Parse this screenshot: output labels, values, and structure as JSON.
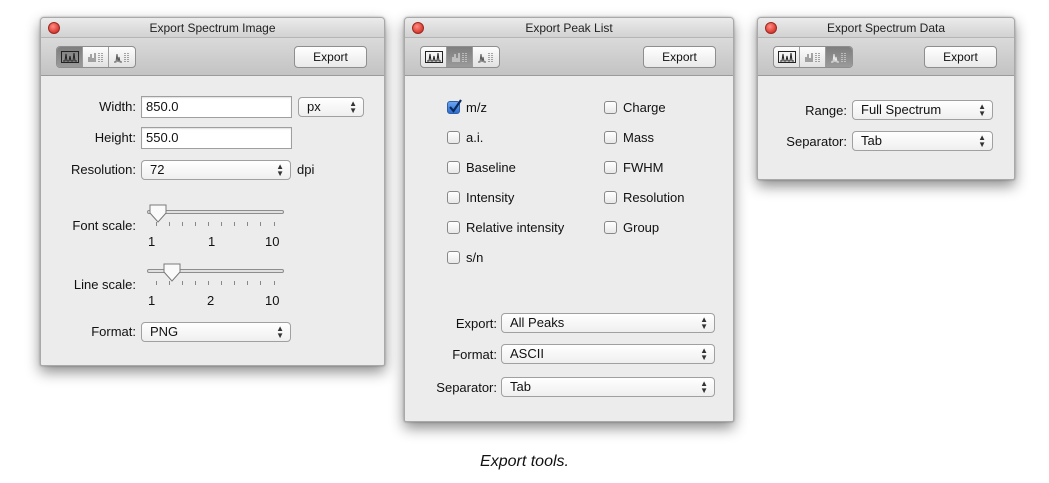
{
  "image_window": {
    "title": "Export Spectrum Image",
    "export_label": "Export",
    "width_label": "Width:",
    "width_value": "850.0",
    "unit": "px",
    "height_label": "Height:",
    "height_value": "550.0",
    "resolution_label": "Resolution:",
    "resolution_value": "72",
    "resolution_unit": "dpi",
    "font_scale_label": "Font scale:",
    "font_scale": {
      "min": "1",
      "value": "1",
      "max": "10"
    },
    "line_scale_label": "Line scale:",
    "line_scale": {
      "min": "1",
      "value": "2",
      "max": "10"
    },
    "format_label": "Format:",
    "format_value": "PNG"
  },
  "peak_window": {
    "title": "Export Peak List",
    "export_label": "Export",
    "checkboxes_left": [
      {
        "label": "m/z",
        "checked": true
      },
      {
        "label": "a.i.",
        "checked": false
      },
      {
        "label": "Baseline",
        "checked": false
      },
      {
        "label": "Intensity",
        "checked": false
      },
      {
        "label": "Relative intensity",
        "checked": false
      },
      {
        "label": "s/n",
        "checked": false
      }
    ],
    "checkboxes_right": [
      {
        "label": "Charge",
        "checked": false
      },
      {
        "label": "Mass",
        "checked": false
      },
      {
        "label": "FWHM",
        "checked": false
      },
      {
        "label": "Resolution",
        "checked": false
      },
      {
        "label": "Group",
        "checked": false
      }
    ],
    "export_field_label": "Export:",
    "export_value": "All Peaks",
    "format_label": "Format:",
    "format_value": "ASCII",
    "separator_label": "Separator:",
    "separator_value": "Tab"
  },
  "data_window": {
    "title": "Export Spectrum Data",
    "export_label": "Export",
    "range_label": "Range:",
    "range_value": "Full Spectrum",
    "separator_label": "Separator:",
    "separator_value": "Tab"
  },
  "caption": "Export tools.",
  "colors": {
    "close_button": "#e0443a",
    "checkbox_checked": "#2d6fcd",
    "window_bg": "#ececec"
  },
  "icons": [
    "close-icon",
    "spectrum-icon",
    "peak-list-icon",
    "data-icon",
    "checkmark-icon",
    "updown-arrows-icon"
  ]
}
